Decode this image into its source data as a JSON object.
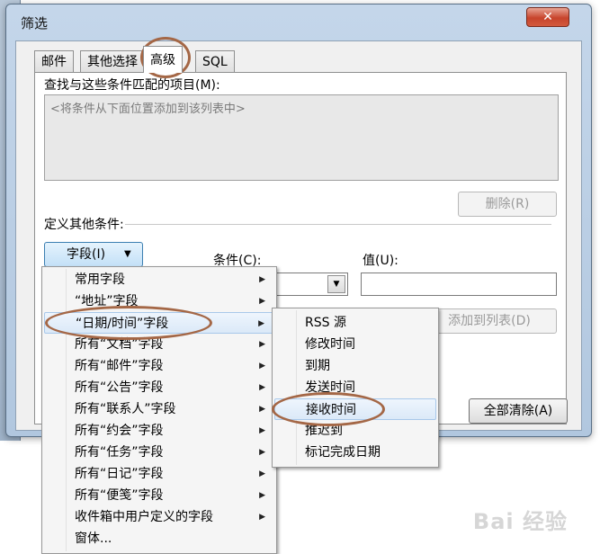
{
  "background": {
    "title_char": "高"
  },
  "window": {
    "title": "筛选",
    "close_glyph": "✕"
  },
  "tabs": [
    {
      "label": "邮件"
    },
    {
      "label": "其他选择"
    },
    {
      "label": "高级",
      "active": true
    },
    {
      "label": "SQL"
    }
  ],
  "advanced": {
    "find_label": "查找与这些条件匹配的项目(M):",
    "criteria_placeholder": "<将条件从下面位置添加到该列表中>",
    "delete_button": "删除(R)",
    "define_label": "定义其他条件:",
    "field_button": "字段(I)",
    "condition_label": "条件(C):",
    "value_label": "值(U):",
    "add_to_list_button": "添加到列表(D)"
  },
  "footer": {
    "clear_all_button": "全部清除(A)"
  },
  "field_menu": {
    "items": [
      {
        "label": "常用字段",
        "submenu": true
      },
      {
        "label": "“地址”字段",
        "submenu": true
      },
      {
        "label": "“日期/时间”字段",
        "submenu": true,
        "highlighted": true
      },
      {
        "label": "所有“文档”字段",
        "submenu": true
      },
      {
        "label": "所有“邮件”字段",
        "submenu": true
      },
      {
        "label": "所有“公告”字段",
        "submenu": true
      },
      {
        "label": "所有“联系人”字段",
        "submenu": true
      },
      {
        "label": "所有“约会”字段",
        "submenu": true
      },
      {
        "label": "所有“任务”字段",
        "submenu": true
      },
      {
        "label": "所有“日记”字段",
        "submenu": true
      },
      {
        "label": "所有“便笺”字段",
        "submenu": true
      },
      {
        "label": "收件箱中用户定义的字段",
        "submenu": true
      },
      {
        "label": "窗体...",
        "submenu": false
      }
    ]
  },
  "date_submenu": {
    "items": [
      {
        "label": "RSS 源"
      },
      {
        "label": "修改时间"
      },
      {
        "label": "到期"
      },
      {
        "label": "发送时间"
      },
      {
        "label": "接收时间",
        "highlighted": true
      },
      {
        "label": "推迟到"
      },
      {
        "label": "标记完成日期"
      }
    ]
  },
  "watermark": "Bai 经验",
  "colors": {
    "annotation": "#a46746",
    "highlight": "#dbe9f8",
    "close": "#c7442c"
  }
}
